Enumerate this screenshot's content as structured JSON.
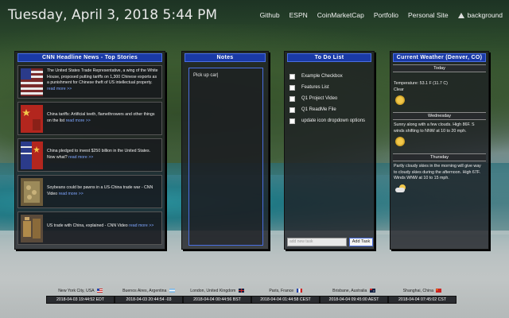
{
  "header": {
    "datetime": "Tuesday, April 3, 2018 5:44 PM",
    "nav": [
      "Github",
      "ESPN",
      "CoinMarketCap",
      "Portfolio",
      "Personal Site"
    ],
    "bg_toggle_label": "background"
  },
  "news": {
    "title": "CNN Headline News - Top Stories",
    "more": "read more >>",
    "items": [
      {
        "text": "The United States Trade Representative, a wing of the White House, proposed putting tariffs on 1,300 Chinese exports as a punishment for Chinese theft of US intellectual property.",
        "thumb": "us-flag-icon"
      },
      {
        "text": "China tariffs: Artificial teeth, flamethrowers and other things on the list",
        "thumb": "china-flag-icon"
      },
      {
        "text": "China pledged to invest $250 billion in the United States. Now what?",
        "thumb": "us-china-flags-icon"
      },
      {
        "text": "Soybeans could be pawns in a US-China trade war - CNN Video",
        "thumb": "soybeans-photo"
      },
      {
        "text": "US trade with China, explained - CNN Video",
        "thumb": "trade-photo"
      }
    ]
  },
  "notes": {
    "title": "Notes",
    "content": "Pick up car|"
  },
  "todo": {
    "title": "To Do List",
    "items": [
      "Example Checkbox",
      "Features List",
      "Q1 Project Video",
      "Q1 ReadMe File",
      "update icon dropdown options"
    ],
    "input_placeholder": "add new task",
    "add_label": "Add Task"
  },
  "weather": {
    "title": "Current Weather (Denver, CO)",
    "days": [
      {
        "day": "Today",
        "lines": [
          "Temperature: 53.1 F (11.7 C)",
          "Clear"
        ],
        "icon": "sun-icon"
      },
      {
        "day": "Wednesday",
        "lines": [
          "Sunny along with a few clouds. High 86F. S winds shifting to NNW at 10 to 20 mph."
        ],
        "icon": "sun-icon"
      },
      {
        "day": "Thursday",
        "lines": [
          "Partly cloudy skies in the morning will give way to cloudy skies during the afternoon. High 67F. Winds WNW at 10 to 15 mph."
        ],
        "icon": "partly-cloudy-icon"
      }
    ]
  },
  "clocks": [
    {
      "city": "New York City, USA",
      "time": "2018-04-03 19:44:52 EDT",
      "flag": "us-flag"
    },
    {
      "city": "Buenos Aires, Argentina",
      "time": "2018-04-03 20:44:54 -03",
      "flag": "argentina-flag"
    },
    {
      "city": "London, United Kingdom",
      "time": "2018-04-04 00:44:56 BST",
      "flag": "uk-flag"
    },
    {
      "city": "Paris, France",
      "time": "2018-04-04 01:44:58 CEST",
      "flag": "france-flag"
    },
    {
      "city": "Brisbane, Australia",
      "time": "2018-04-04 09:45:00 AEST",
      "flag": "australia-flag"
    },
    {
      "city": "Shanghai, China",
      "time": "2018-04-04 07:45:02 CST",
      "flag": "china-flag"
    }
  ],
  "colors": {
    "panel_header": "#1a3aa6",
    "link": "#7fa6ff",
    "accent_border": "#4a6ee0"
  }
}
